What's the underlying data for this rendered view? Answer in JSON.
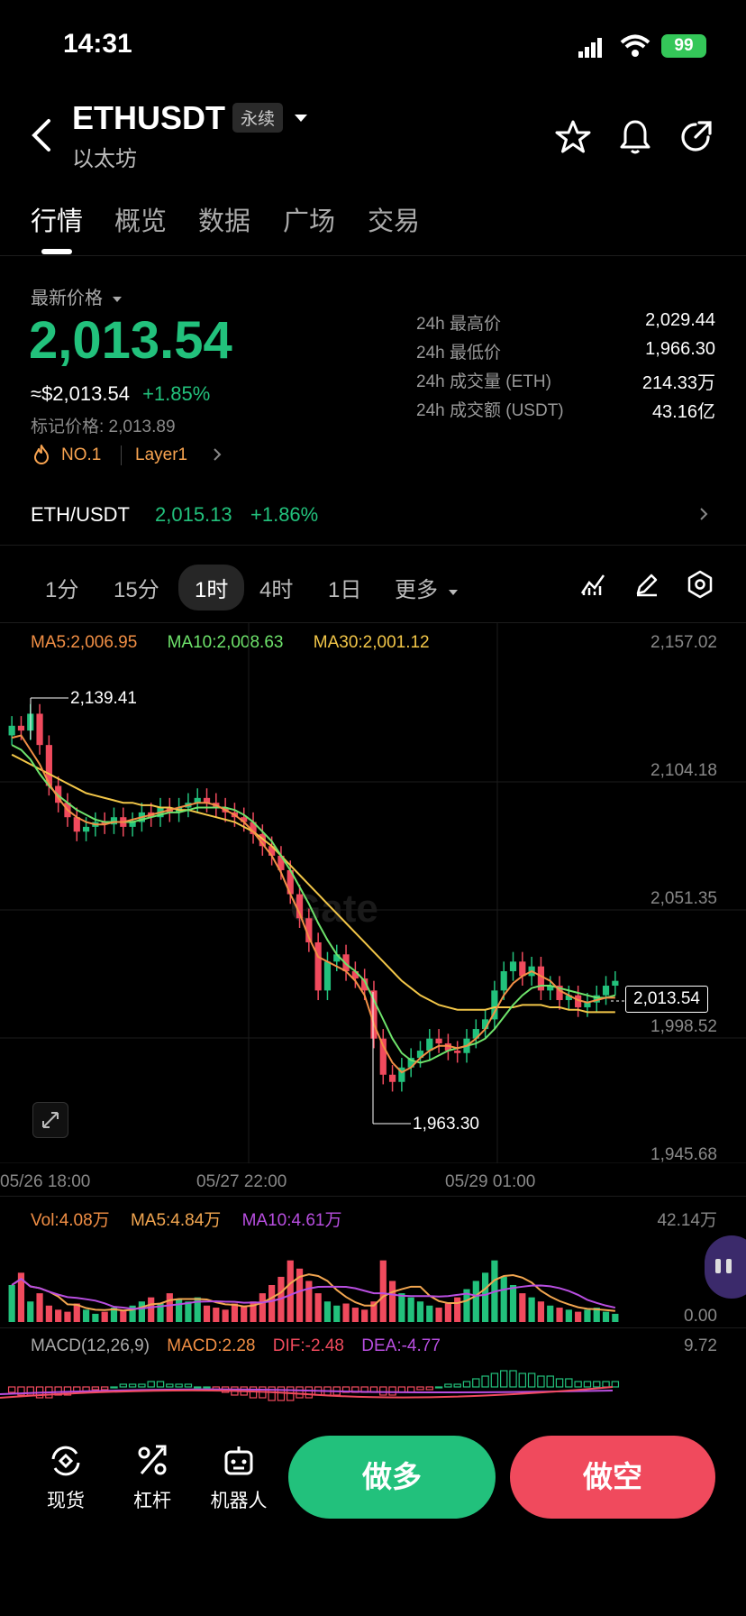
{
  "status": {
    "time": "14:31",
    "battery": "99"
  },
  "header": {
    "symbol": "ETHUSDT",
    "contract_type": "永续",
    "name": "以太坊"
  },
  "tabs": [
    "行情",
    "概览",
    "数据",
    "广场",
    "交易"
  ],
  "price": {
    "selector_label": "最新价格",
    "last": "2,013.54",
    "usd_approx": "≈$2,013.54",
    "change_pct": "+1.85%",
    "mark_price_label": "标记价格: 2,013.89",
    "rank": "NO.1",
    "tag": "Layer1"
  },
  "stats": [
    {
      "label": "24h 最高价",
      "value": "2,029.44"
    },
    {
      "label": "24h 最低价",
      "value": "1,966.30"
    },
    {
      "label": "24h 成交量 (ETH)",
      "value": "214.33万"
    },
    {
      "label": "24h 成交额 (USDT)",
      "value": "43.16亿"
    }
  ],
  "spot": {
    "pair": "ETH/USDT",
    "price": "2,015.13",
    "change": "+1.86%"
  },
  "intervals": [
    "1分",
    "15分",
    "1时",
    "4时",
    "1日",
    "更多"
  ],
  "active_interval": "1时",
  "chart": {
    "ma_legend": {
      "ma5": "MA5:2,006.95",
      "ma10": "MA10:2,008.63",
      "ma30": "MA30:2,001.12"
    },
    "y_ticks": [
      "2,157.02",
      "2,104.18",
      "2,051.35",
      "1,998.52",
      "1,945.68"
    ],
    "high_label": "2,139.41",
    "low_label": "1,963.30",
    "current_price": "2,013.54",
    "x_ticks": [
      "05/26 18:00",
      "05/27 22:00",
      "05/29 01:00"
    ],
    "watermark": "Gate",
    "vol_legend": {
      "vol": "Vol:4.08万",
      "ma5": "MA5:4.84万",
      "ma10": "MA10:4.61万"
    },
    "vol_max": "42.14万",
    "vol_min": "0.00",
    "macd_legend": {
      "params": "MACD(12,26,9)",
      "macd": "MACD:2.28",
      "dif": "DIF:-2.48",
      "dea": "DEA:-4.77"
    },
    "macd_max": "9.72"
  },
  "chart_data": {
    "type": "candlestick",
    "ylim": [
      1945.68,
      2157.02
    ],
    "y_ticks": [
      2157.02,
      2104.18,
      2051.35,
      1998.52,
      1945.68
    ],
    "x_ticks": [
      "05/26 18:00",
      "05/27 22:00",
      "05/29 01:00"
    ],
    "close": [
      2120,
      2118,
      2125,
      2112,
      2095,
      2088,
      2082,
      2076,
      2078,
      2080,
      2079,
      2082,
      2078,
      2080,
      2084,
      2082,
      2086,
      2084,
      2086,
      2088,
      2090,
      2088,
      2086,
      2084,
      2082,
      2080,
      2075,
      2070,
      2066,
      2060,
      2050,
      2040,
      2030,
      2010,
      2022,
      2025,
      2018,
      2015,
      2010,
      1990,
      1975,
      1972,
      1978,
      1982,
      1985,
      1990,
      1988,
      1985,
      1984,
      1990,
      1994,
      1998,
      2010,
      2018,
      2022,
      2016,
      2020,
      2010,
      2012,
      2006,
      2008,
      2003,
      2005,
      2008,
      2012,
      2014
    ],
    "ma5": [
      2115,
      2116,
      2110,
      2104,
      2096,
      2090,
      2085,
      2082,
      2080,
      2079,
      2079,
      2080,
      2080,
      2081,
      2082,
      2083,
      2084,
      2085,
      2086,
      2087,
      2088,
      2088,
      2087,
      2085,
      2083,
      2080,
      2076,
      2071,
      2066,
      2059,
      2050,
      2042,
      2032,
      2024,
      2022,
      2020,
      2018,
      2014,
      2008,
      1996,
      1987,
      1980,
      1976,
      1978,
      1982,
      1985,
      1987,
      1987,
      1986,
      1987,
      1990,
      1994,
      2001,
      2008,
      2013,
      2016,
      2018,
      2016,
      2014,
      2010,
      2008,
      2006,
      2005,
      2006,
      2007,
      2007
    ],
    "ma10": [
      2112,
      2110,
      2106,
      2100,
      2095,
      2091,
      2088,
      2085,
      2083,
      2081,
      2080,
      2080,
      2080,
      2080,
      2081,
      2082,
      2083,
      2084,
      2084,
      2085,
      2086,
      2086,
      2086,
      2086,
      2085,
      2083,
      2080,
      2076,
      2072,
      2066,
      2060,
      2053,
      2046,
      2038,
      2031,
      2025,
      2021,
      2018,
      2014,
      2006,
      1998,
      1990,
      1984,
      1981,
      1980,
      1981,
      1983,
      1985,
      1986,
      1987,
      1988,
      1990,
      1994,
      1999,
      2004,
      2008,
      2011,
      2012,
      2012,
      2011,
      2010,
      2009,
      2008,
      2007,
      2007,
      2008
    ],
    "ma30": [
      2108,
      2106,
      2104,
      2102,
      2100,
      2098,
      2096,
      2094,
      2092,
      2091,
      2090,
      2089,
      2088,
      2088,
      2087,
      2087,
      2086,
      2086,
      2085,
      2085,
      2084,
      2083,
      2082,
      2081,
      2080,
      2078,
      2076,
      2073,
      2070,
      2066,
      2062,
      2058,
      2054,
      2050,
      2046,
      2042,
      2038,
      2034,
      2030,
      2026,
      2022,
      2018,
      2014,
      2011,
      2008,
      2006,
      2004,
      2003,
      2002,
      2002,
      2002,
      2002,
      2003,
      2003,
      2003,
      2004,
      2004,
      2004,
      2003,
      2003,
      2002,
      2002,
      2001,
      2001,
      2001,
      2001
    ],
    "high": 2139.41,
    "low": 1963.3,
    "last": 2013.54,
    "volume": [
      18,
      24,
      10,
      14,
      8,
      6,
      5,
      9,
      6,
      4,
      5,
      7,
      6,
      8,
      10,
      12,
      9,
      14,
      11,
      10,
      12,
      8,
      7,
      6,
      9,
      8,
      10,
      14,
      18,
      22,
      30,
      26,
      20,
      14,
      10,
      8,
      9,
      7,
      6,
      10,
      30,
      20,
      14,
      12,
      10,
      8,
      7,
      9,
      12,
      16,
      20,
      24,
      30,
      22,
      18,
      14,
      12,
      10,
      8,
      7,
      6,
      5,
      6,
      7,
      5,
      4
    ],
    "volume_ylim": [
      0,
      42.14
    ],
    "macd_hist": [
      -2,
      -3,
      -3,
      -4,
      -4,
      -3,
      -3,
      -2,
      -2,
      -1,
      -1,
      0,
      1,
      1,
      1,
      2,
      2,
      1,
      1,
      1,
      0,
      0,
      -1,
      -2,
      -3,
      -3,
      -4,
      -4,
      -5,
      -5,
      -5,
      -4,
      -4,
      -3,
      -3,
      -3,
      -2,
      -2,
      -2,
      -2,
      -3,
      -3,
      -2,
      -2,
      -1,
      -1,
      0,
      1,
      1,
      2,
      3,
      4,
      5,
      6,
      6,
      5,
      5,
      4,
      4,
      3,
      3,
      2,
      2,
      2,
      2,
      2
    ]
  },
  "actions": {
    "spot": "现货",
    "leverage": "杠杆",
    "bot": "机器人",
    "long": "做多",
    "short": "做空"
  }
}
